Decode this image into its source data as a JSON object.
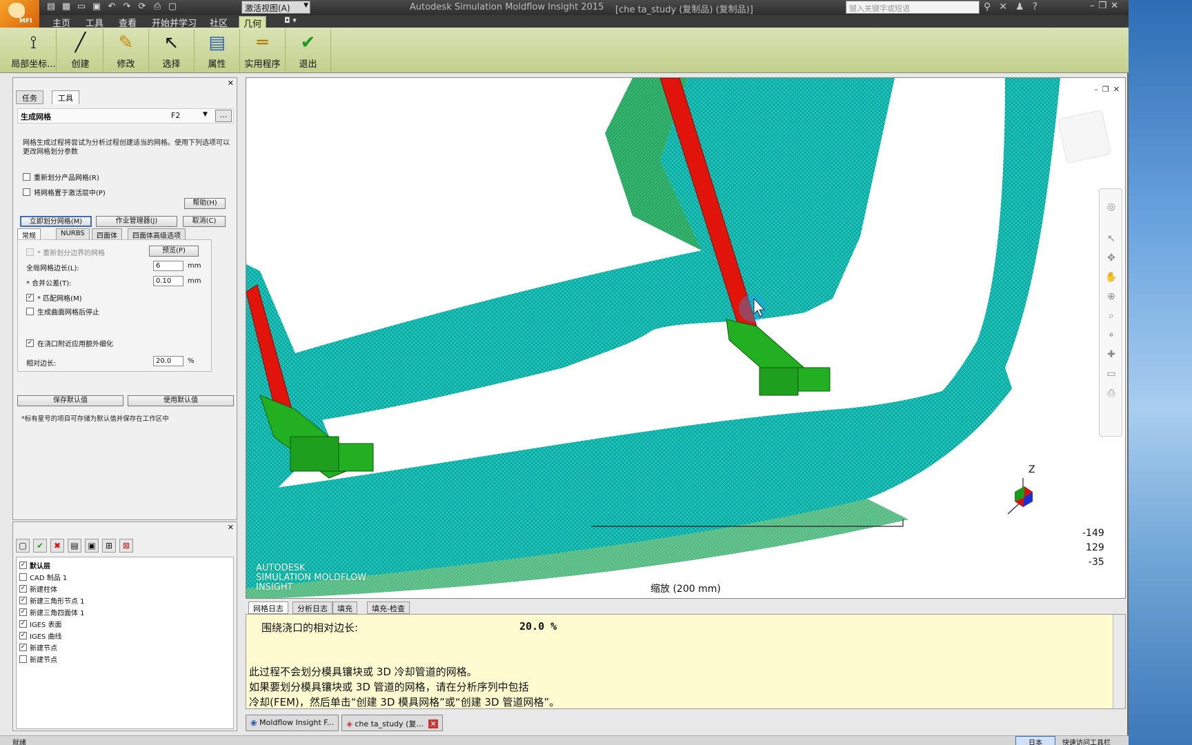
{
  "titlebar": {
    "view_select": "激活视图(A)",
    "app_title": "Autodesk Simulation Moldflow Insight 2015",
    "file_title": "[che ta_study (复制品) (复制品)]",
    "search_placeholder": "键入关键字或短语",
    "logo_text": "MFI"
  },
  "menubar": {
    "tabs": [
      "主页",
      "工具",
      "查看",
      "开始并学习",
      "社区",
      "几何"
    ],
    "active_tab": "几何"
  },
  "ribbon": {
    "buttons": [
      "局部坐标...",
      "创建",
      "修改",
      "选择",
      "属性",
      "实用程序",
      "退出"
    ]
  },
  "leftpanel": {
    "tabs": [
      "任务",
      "工具"
    ],
    "tool_title": "生成网格",
    "tool_key": "F2",
    "description": "网格生成过程将尝试为分析过程创建适当的网格。使用下列选项可以更改网格划分参数",
    "options": [
      "重新划分产品网格(R)",
      "将网格置于激活层中(P)"
    ],
    "help_button": "帮助(H)",
    "action_buttons": [
      "立即划分网格(M)",
      "作业管理器(J)",
      "取消(C)"
    ],
    "subtabs": [
      "常规",
      "NURBS",
      "四面体",
      "四面体高级选项"
    ],
    "remesh_boundary": "* 重新划分边界的网格",
    "preview_button": "预览(P)",
    "global_edge_label": "全局网格边长(L):",
    "global_edge_value": "6",
    "global_edge_unit": "mm",
    "merge_tol_label": "* 合并公差(T):",
    "merge_tol_value": "0.10",
    "merge_tol_unit": "mm",
    "match_mesh": "* 匹配网格(M)",
    "stop_surface": "生成曲面网格后停止",
    "gate_refine": "在浇口附近应用额外细化",
    "relative_edge_label": "相对边长:",
    "relative_edge_value": "20.0",
    "relative_edge_unit": "%",
    "save_defaults": "保存默认值",
    "use_defaults": "使用默认值",
    "footnote": "*标有星号的项目可存储为默认值并保存在工作区中"
  },
  "layers": {
    "items": [
      {
        "name": "默认层",
        "checked": true,
        "bold": true
      },
      {
        "name": "CAD 制品 1",
        "checked": false,
        "bold": false
      },
      {
        "name": "新建柱体",
        "checked": true,
        "bold": false
      },
      {
        "name": "新建三角形节点 1",
        "checked": true,
        "bold": false
      },
      {
        "name": "新建三角四面体 1",
        "checked": true,
        "bold": false
      },
      {
        "name": "IGES 表面",
        "checked": true,
        "bold": false
      },
      {
        "name": "IGES 曲线",
        "checked": true,
        "bold": false
      },
      {
        "name": "新建节点",
        "checked": true,
        "bold": false
      },
      {
        "name": "新建节点",
        "checked": false,
        "bold": false
      }
    ]
  },
  "viewport": {
    "brand_line1": "AUTODESK",
    "brand_line2": "SIMULATION MOLDFLOW",
    "brand_line3": "INSIGHT",
    "scale_label": "缩放 (200 mm)",
    "coord_x": "-149",
    "coord_y": "129",
    "coord_z": "-35",
    "axis_z": "Z"
  },
  "log": {
    "tabs": [
      "网格日志",
      "分析日志",
      "填充",
      "填充-检查"
    ],
    "line1_label": "围绕浇口的相对边长:",
    "line1_value": "20.0 %",
    "line2": "此过程不会划分模具镶块或 3D 冷却管道的网格。",
    "line3": "如果要划分模具镶块或 3D 管道的网格，请在分析序列中包括",
    "line4": "冷却(FEM)，然后单击“创建 3D 模具网格”或“创建 3D 管道网格”。"
  },
  "taskbar": {
    "items": [
      "Moldflow Insight F...",
      "che ta_study (复..."
    ]
  },
  "status": {
    "left": "就绪",
    "box": "日本",
    "right": "快速访问工具栏"
  },
  "colors": {
    "ribbon": "#c8d495",
    "mesh": "#19c8d2",
    "mesh_inner": "#1b9b2a",
    "gate": "#e0140a",
    "log_bg": "#fffbd0"
  }
}
